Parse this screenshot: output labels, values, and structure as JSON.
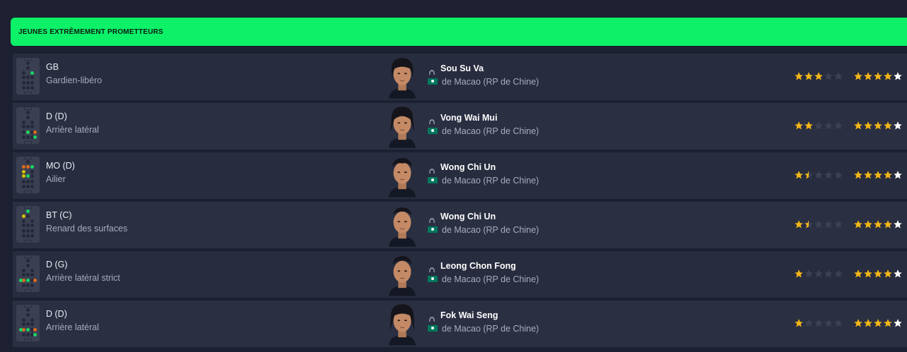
{
  "panel": {
    "title": "JEUNES EXTRÊMEMENT PROMETTEURS"
  },
  "colors": {
    "header_bg": "#0cf168",
    "star_gold": "#f3b718",
    "star_empty": "#3c4254",
    "star_white": "#ffffff",
    "dot_green": "#17d765",
    "dot_yellow": "#d5c400",
    "dot_orange": "#e0691e"
  },
  "players": [
    {
      "position": "GB",
      "role": "Gardien-libéro",
      "name": "Sou Su Va",
      "nation": "de Macao (RP de Chine)",
      "current_ability_stars": 3,
      "potential_ability_stars": 4.5,
      "pitch_dots": [
        [
          "green",
          5
        ]
      ]
    },
    {
      "position": "D (D)",
      "role": "Arrière latéral",
      "name": "Vong Wai Mui",
      "nation": "de Macao (RP de Chine)",
      "current_ability_stars": 2,
      "potential_ability_stars": 4.5,
      "pitch_dots": [
        [
          "orange",
          9
        ],
        [
          "green",
          13
        ],
        [
          "orange",
          12
        ],
        [
          "green",
          14
        ]
      ]
    },
    {
      "position": "MO (D)",
      "role": "Ailier",
      "name": "Wong Chi Un",
      "nation": "de Macao (RP de Chine)",
      "current_ability_stars": 1.5,
      "potential_ability_stars": 4.5,
      "pitch_dots": [
        [
          "orange",
          1
        ],
        [
          "orange",
          2
        ],
        [
          "green",
          3
        ],
        [
          "yellow",
          4
        ],
        [
          "yellow",
          6
        ],
        [
          "green",
          7
        ]
      ]
    },
    {
      "position": "BT (C)",
      "role": "Renard des surfaces",
      "name": "Wong Chi Un",
      "nation": "de Macao (RP de Chine)",
      "current_ability_stars": 1.5,
      "potential_ability_stars": 4.5,
      "pitch_dots": [
        [
          "green",
          0
        ],
        [
          "yellow",
          2
        ]
      ]
    },
    {
      "position": "D (G)",
      "role": "Arrière latéral strict",
      "name": "Leong Chon Fong",
      "nation": "de Macao (RP de Chine)",
      "current_ability_stars": 1,
      "potential_ability_stars": 4.5,
      "pitch_dots": [
        [
          "orange",
          8
        ],
        [
          "green",
          10
        ],
        [
          "green",
          13
        ],
        [
          "orange",
          12
        ]
      ]
    },
    {
      "position": "D (D)",
      "role": "Arrière latéral",
      "name": "Fok Wai Seng",
      "nation": "de Macao (RP de Chine)",
      "current_ability_stars": 1,
      "potential_ability_stars": 4.5,
      "pitch_dots": [
        [
          "orange",
          8
        ],
        [
          "green",
          10
        ],
        [
          "orange",
          12
        ],
        [
          "green",
          14
        ],
        [
          "green",
          13
        ]
      ]
    }
  ]
}
